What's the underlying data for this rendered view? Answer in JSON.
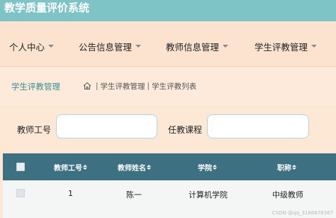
{
  "app": {
    "title": "教学质量评价系统"
  },
  "nav": {
    "items": [
      {
        "label": "个人中心"
      },
      {
        "label": "公告信息管理"
      },
      {
        "label": "教师信息管理"
      },
      {
        "label": "学生评教管理"
      }
    ]
  },
  "breadcrumb": {
    "title": "学生评教管理",
    "path": [
      "学生评教管理",
      "学生评教列表"
    ]
  },
  "search": {
    "teacher_id_label": "教师工号",
    "teacher_id_value": "",
    "course_label": "任教课程",
    "course_value": ""
  },
  "table": {
    "columns": [
      {
        "label": "教师工号"
      },
      {
        "label": "教师姓名"
      },
      {
        "label": "学院"
      },
      {
        "label": "职称"
      }
    ],
    "rows": [
      [
        "1",
        "陈一",
        "计算机学院",
        "中级教师"
      ]
    ]
  },
  "watermark": "CSDN @qq_3166878367",
  "colors": {
    "title_bar": "#7ec4c6",
    "nav_bg": "#fbe3cf",
    "table_header": "#3d7182",
    "input_border": "#a9d9e8"
  },
  "icons": {
    "nav_dropdown": "caret-down-icon",
    "breadcrumb_home": "home-icon",
    "column_sort": "sort-icon"
  }
}
